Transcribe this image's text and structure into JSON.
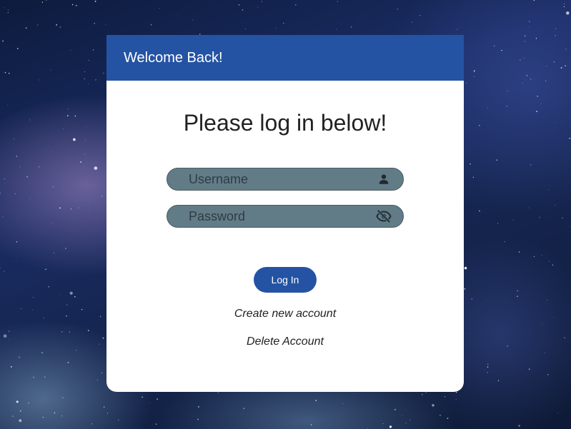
{
  "card": {
    "title": "Welcome Back!",
    "heading": "Please log in below!"
  },
  "form": {
    "username": {
      "placeholder": "Username",
      "value": "",
      "icon": "person-icon"
    },
    "password": {
      "placeholder": "Password",
      "value": "",
      "icon": "eye-off-icon"
    },
    "login_label": "Log In",
    "create_account_label": "Create new account",
    "delete_account_label": "Delete Account"
  },
  "colors": {
    "brand": "#2453a3",
    "field_bg": "#627c87",
    "card_bg": "#ffffff"
  }
}
